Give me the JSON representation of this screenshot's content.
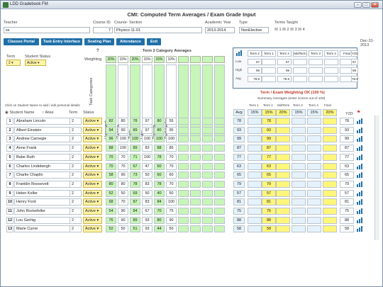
{
  "window": {
    "title": "LDD Gradebook FM",
    "min": "–",
    "max": "□",
    "close": "✕"
  },
  "header": {
    "title": "CMI: Computed Term Averages / Exam Grade  Input",
    "date": "Dec-31-2013"
  },
  "fields": {
    "teacher_label": "Teacher",
    "teacher_value": "ss",
    "course_id_label": "Course ID",
    "course_id_value": "7",
    "course_section_label": "Course- Section",
    "course_section_value": "Physics 11-01",
    "year_label": "Academic Year",
    "year_value": "2013-2014",
    "type_label": "Type",
    "type_value": "NonElective",
    "terms_label": "Terms Taught",
    "terms": [
      "1",
      "2",
      "3",
      "4"
    ]
  },
  "nav": [
    "Classes Portal",
    "Task Entry Interface",
    "Seating Plan",
    "Attendance",
    "Exit"
  ],
  "filters": {
    "term_label": "Term",
    "term_value": "2",
    "status_label": "Student Status",
    "status_value": "Active"
  },
  "categories": {
    "title": "Term 2 Category Averages",
    "weighting_label": "Weighting",
    "help": "?",
    "task_categories_label": "Task Categories",
    "names": [
      "Homework",
      "Quizzes",
      "Tests",
      "Labs",
      "Projects",
      "Participation",
      "",
      "",
      "",
      ""
    ],
    "weights": [
      "20%",
      "15%",
      "20%",
      "15%",
      "15%",
      "10%",
      "",
      "",
      "",
      ""
    ]
  },
  "stats_panel": {
    "headers": [
      "Term 2",
      "Term 1",
      "Term 2",
      "MidTerm",
      "Term 3",
      "Term 4",
      "Final",
      "Y2D"
    ],
    "rows": [
      {
        "label": "Low",
        "vals": [
          "57",
          "",
          "57",
          "",
          "",
          "",
          "",
          "57"
        ]
      },
      {
        "label": "High",
        "vals": [
          "99",
          "",
          "99",
          "",
          "",
          "",
          "",
          "99"
        ]
      },
      {
        "label": "Avg",
        "vals": [
          "78.9",
          "",
          "78.9",
          "",
          "",
          "",
          "",
          "78.9"
        ]
      }
    ]
  },
  "weighting": {
    "title": "Term / Exam Weighting OK (100 %)",
    "subtitle": "Summary Averages (enter scores out of 100)",
    "headers": [
      "Term 1",
      "Term 2",
      "MidTerm",
      "Term 3",
      "Term 4",
      "Final"
    ],
    "values": [
      "15%",
      "15%",
      "20%",
      "15%",
      "15%",
      "20%"
    ],
    "avg_label": "Avg",
    "y2d_label": "Y2D"
  },
  "list_hint": "Click on Student Name to add / edit personal details",
  "sort": {
    "name_label": "Student Name",
    "alias_label": "Alias",
    "term_label": "Term",
    "status_label": "Status"
  },
  "students": [
    {
      "n": "1",
      "name": "Abraham Lincoln",
      "term": "2",
      "status": "Active",
      "s": [
        "82",
        "80",
        "78",
        "97",
        "80",
        "55"
      ],
      "avg": "78",
      "t2": "78",
      "y2d": "78"
    },
    {
      "n": "2",
      "name": "Albert Einstein",
      "term": "2",
      "status": "Active",
      "s": [
        "94",
        "90",
        "89",
        "97",
        "80",
        "95"
      ],
      "avg": "93",
      "t2": "93",
      "y2d": "93"
    },
    {
      "n": "3",
      "name": "Andrew Carnegie",
      "term": "2",
      "status": "Active",
      "s": [
        "96",
        "100",
        "100",
        "100",
        "100",
        "100"
      ],
      "avg": "99",
      "t2": "99",
      "y2d": "99"
    },
    {
      "n": "4",
      "name": "Anne Frank",
      "term": "2",
      "status": "Active",
      "s": [
        "88",
        "100",
        "89",
        "83",
        "88",
        "85"
      ],
      "avg": "87",
      "t2": "87",
      "y2d": "87"
    },
    {
      "n": "5",
      "name": "Babe Ruth",
      "term": "2",
      "status": "Active",
      "s": [
        "70",
        "70",
        "71",
        "100",
        "78",
        "70"
      ],
      "avg": "77",
      "t2": "77",
      "y2d": "77"
    },
    {
      "n": "6",
      "name": "Charles Lindebergh",
      "term": "2",
      "status": "Active",
      "s": [
        "70",
        "70",
        "67",
        "47",
        "60",
        "70"
      ],
      "avg": "63",
      "t2": "63",
      "y2d": "63"
    },
    {
      "n": "7",
      "name": "Charlie Chaplin",
      "term": "2",
      "status": "Active",
      "s": [
        "58",
        "90",
        "73",
        "50",
        "60",
        "60"
      ],
      "avg": "65",
      "t2": "65",
      "y2d": "65"
    },
    {
      "n": "8",
      "name": "Franklin Roosevelt",
      "term": "2",
      "status": "Active",
      "s": [
        "80",
        "80",
        "78",
        "83",
        "78",
        "70"
      ],
      "avg": "79",
      "t2": "79",
      "y2d": "79"
    },
    {
      "n": "9",
      "name": "Helen Keller",
      "term": "2",
      "status": "Active",
      "s": [
        "52",
        "50",
        "69",
        "50",
        "40",
        "50"
      ],
      "avg": "57",
      "t2": "57",
      "y2d": "57"
    },
    {
      "n": "10",
      "name": "Henry Ford",
      "term": "2",
      "status": "Active",
      "s": [
        "68",
        "70",
        "87",
        "83",
        "84",
        "100"
      ],
      "avg": "81",
      "t2": "81",
      "y2d": "81"
    },
    {
      "n": "11",
      "name": "John Rockefeller",
      "term": "2",
      "status": "Active",
      "s": [
        "54",
        "90",
        "84",
        "67",
        "70",
        "75"
      ],
      "avg": "75",
      "t2": "75",
      "y2d": "75"
    },
    {
      "n": "12",
      "name": "Lou Gerhig",
      "term": "2",
      "status": "Active",
      "s": [
        "76",
        "90",
        "89",
        "93",
        "80",
        "90"
      ],
      "avg": "88",
      "t2": "88",
      "y2d": "88"
    },
    {
      "n": "13",
      "name": "Marie Currie",
      "term": "2",
      "status": "Active",
      "s": [
        "52",
        "50",
        "51",
        "93",
        "44",
        "50"
      ],
      "avg": "58",
      "t2": "58",
      "y2d": "58"
    }
  ]
}
